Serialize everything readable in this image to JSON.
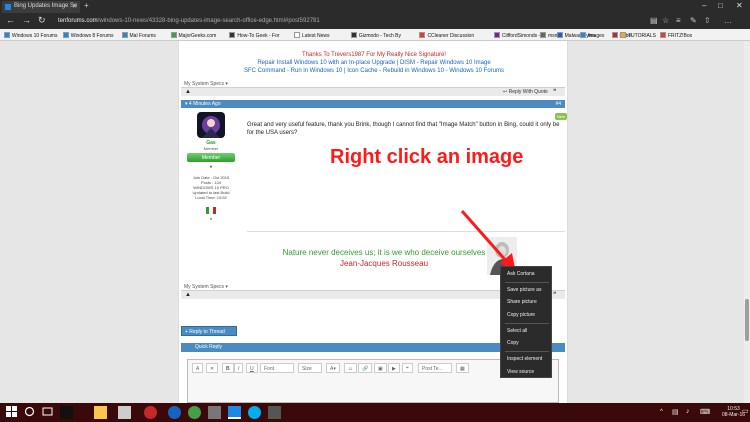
{
  "browser": {
    "tab_title": "Bing Updates Image Se",
    "url_host": "tenforums.com",
    "url_path": "/windows-10-news/43328-bing-updates-image-search-office-edge.html#post592781"
  },
  "favorites": [
    {
      "label": "Windows 10 Forums",
      "color": "#1e88e5"
    },
    {
      "label": "Windows 8 Forums",
      "color": "#1e88e5"
    },
    {
      "label": "Mal Forums",
      "color": "#1e88e5"
    },
    {
      "label": "MajorGeeks.com",
      "color": "#43a047"
    },
    {
      "label": "How-To Geek - For",
      "color": "#333333"
    },
    {
      "label": "Latest News",
      "color": "#ffffff"
    },
    {
      "label": "Gizmodo - Tech By",
      "color": "#333333"
    },
    {
      "label": "CCleaner Discussion",
      "color": "#e53935"
    },
    {
      "label": "CliffordSimonds -",
      "color": "#7b1fa2"
    },
    {
      "label": "Malwarebytes",
      "color": "#1565c0"
    },
    {
      "label": "Kebel",
      "color": "#c62828"
    },
    {
      "label": "msn",
      "color": "#666666"
    },
    {
      "label": "Images",
      "color": "#1e88e5"
    },
    {
      "label": "TUTORIALS",
      "color": "#f9a825"
    },
    {
      "label": "FRITZ!Box",
      "color": "#e53935"
    }
  ],
  "signature": {
    "line1": "Thanks To Trevers1987 For My Really Nice Signature!",
    "line2": "Repair Install Windows 10 with an In-place Upgrade | DISM - Repair Windows 10 Image",
    "line3": "SFC Command - Run in Windows 10 | Icon Cache - Rebuild in Windows 10 - Windows 10 Forums"
  },
  "post": {
    "my_system_specs": "My System Specs",
    "reply_with_quote": "Reply With Quote",
    "time_ago": "4 Minutes Ago",
    "post_number": "#4",
    "author": "Gas",
    "role": "Member",
    "rank_badge": "Member",
    "details": [
      "Join Date : Oct 2015",
      "Posts : 134",
      "WINDOWS 10 PRO",
      "Updated to last Build",
      "Local Time: 10:52"
    ],
    "message": "Great and very useful feature, thank you Brink, though I cannot find that \"Image Match\" button in Bing, could it only be for the USA users?",
    "quote_line1": "Nature never deceives us; it is we who deceive ourselves",
    "quote_line2": "Jean-Jacques  Rousseau",
    "new_badge": "New"
  },
  "annotation": "Right click an image",
  "reply_button": "+ Reply to Thread",
  "quick_reply": "Quick Reply",
  "editor": {
    "font_placeholder": "Font",
    "size_placeholder": "Size",
    "post_template_placeholder": "Post Te..."
  },
  "context_menu": [
    "Ask Cortana",
    "Save picture as",
    "Share picture",
    "Copy picture",
    "Select all",
    "Copy",
    "Inspect element",
    "View source"
  ],
  "taskbar": {
    "time": "10:53",
    "date": "08-Mar-16"
  }
}
